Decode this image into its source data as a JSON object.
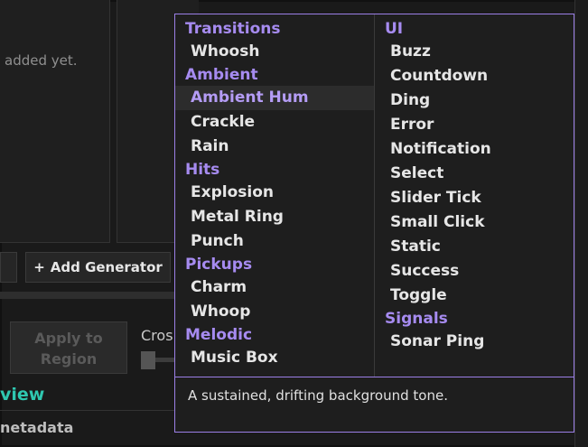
{
  "background": {
    "empty_list_text": "added yet.",
    "add_generator_icon": "plus-icon",
    "add_generator_plus": "+",
    "add_generator_label": "Add Generator",
    "apply_button_line1": "Apply to",
    "apply_button_line2": "Region",
    "crossfade_label_fragment": "Cros",
    "preview_heading_fragment": "view",
    "metadata_heading_fragment": "netadata"
  },
  "menu": {
    "columns": [
      {
        "groups": [
          {
            "label": "Transitions",
            "items": [
              {
                "label": "Whoosh"
              }
            ]
          },
          {
            "label": "Ambient",
            "items": [
              {
                "label": "Ambient Hum",
                "selected": true
              },
              {
                "label": "Crackle"
              },
              {
                "label": "Rain"
              }
            ]
          },
          {
            "label": "Hits",
            "items": [
              {
                "label": "Explosion"
              },
              {
                "label": "Metal Ring"
              },
              {
                "label": "Punch"
              }
            ]
          },
          {
            "label": "Pickups",
            "items": [
              {
                "label": "Charm"
              },
              {
                "label": "Whoop"
              }
            ]
          },
          {
            "label": "Melodic",
            "items": [
              {
                "label": "Music Box"
              }
            ]
          }
        ]
      },
      {
        "groups": [
          {
            "label": "UI",
            "items": [
              {
                "label": "Buzz"
              },
              {
                "label": "Countdown"
              },
              {
                "label": "Ding"
              },
              {
                "label": "Error"
              },
              {
                "label": "Notification"
              },
              {
                "label": "Select"
              },
              {
                "label": "Slider Tick"
              },
              {
                "label": "Small Click"
              },
              {
                "label": "Static"
              },
              {
                "label": "Success"
              },
              {
                "label": "Toggle"
              }
            ]
          },
          {
            "label": "Signals",
            "items": [
              {
                "label": "Sonar Ping"
              }
            ]
          }
        ]
      }
    ],
    "description": "A sustained, drifting background tone."
  },
  "colors": {
    "accent": "#a68bf0",
    "popup_border": "#9b7fe6",
    "preview_heading": "#2fc7b0"
  }
}
